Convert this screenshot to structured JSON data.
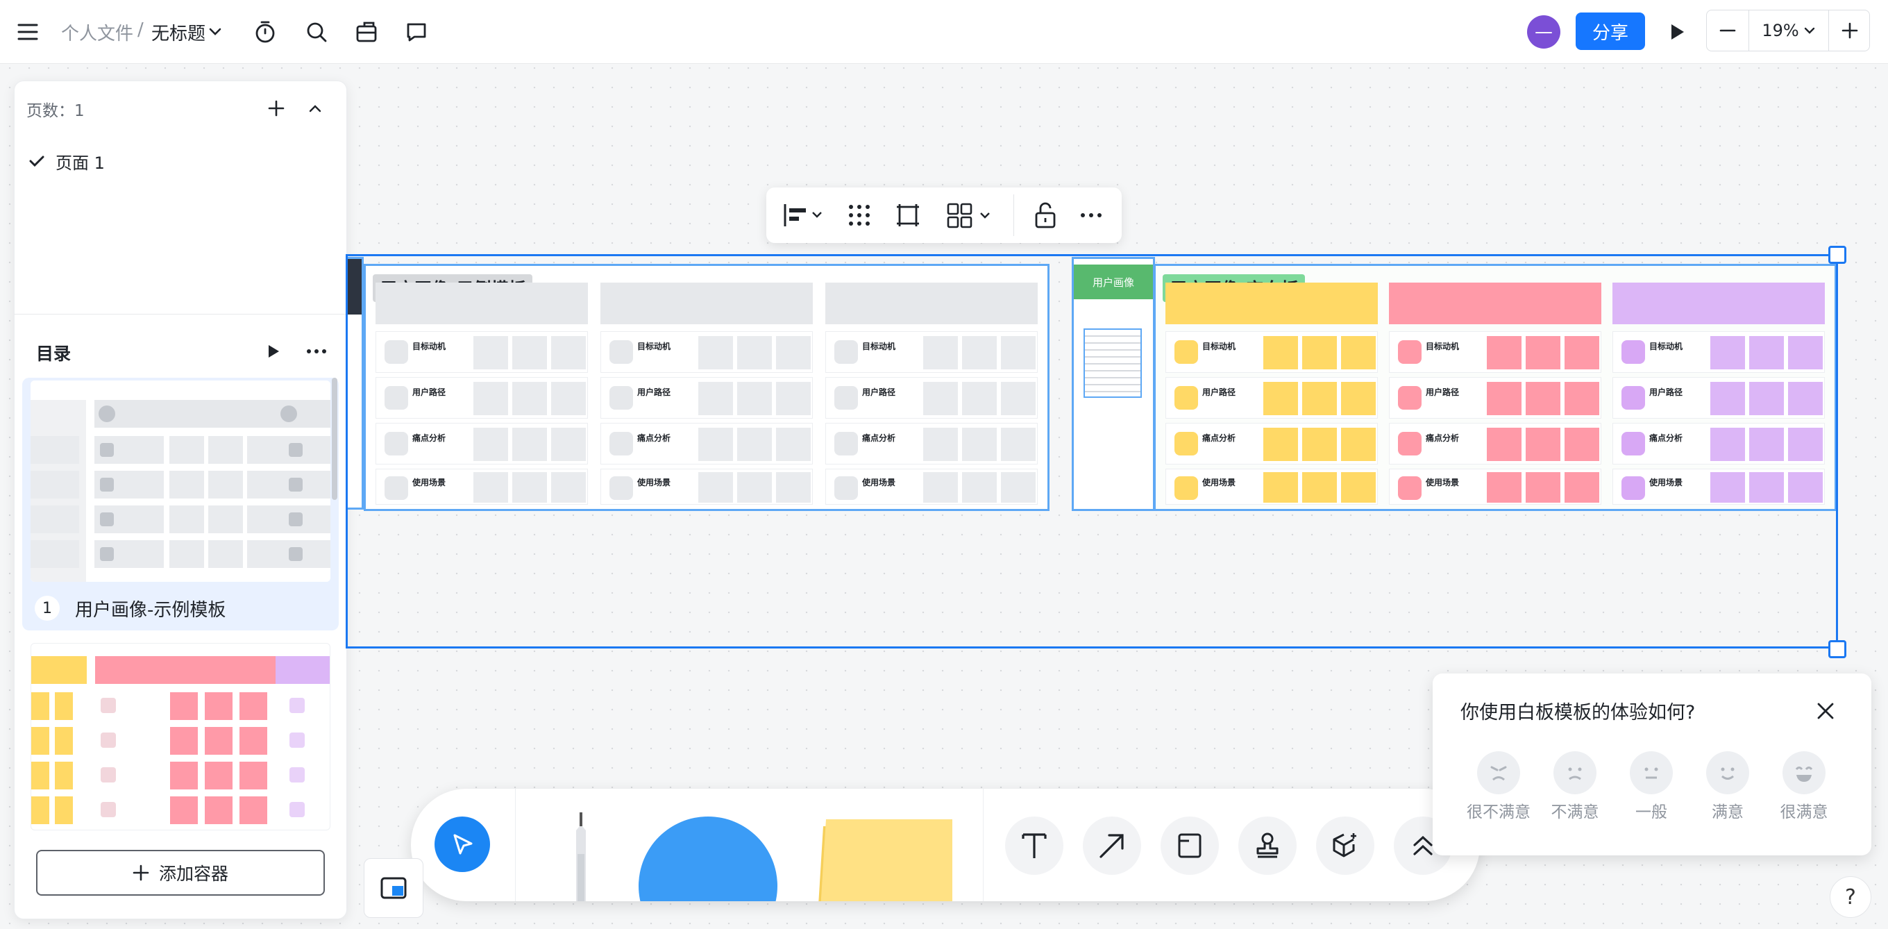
{
  "header": {
    "breadcrumb_parent": "个人文件",
    "breadcrumb_sep": "/",
    "doc_title": "无标题",
    "avatar_text": "—",
    "share_label": "分享",
    "zoom_value": "19%"
  },
  "sidebar": {
    "page_count_label": "页数：1",
    "pages": [
      {
        "label": "页面 1"
      }
    ],
    "toc_title": "目录",
    "toc_items": [
      {
        "index": "1",
        "label": "用户画像-示例模板"
      }
    ],
    "add_container_label": "添加容器"
  },
  "canvas": {
    "board_example_label": "用户画像-示例模板",
    "board_blank_label": "用户画像-空白板",
    "side_card_label": "用户画像",
    "row_titles": [
      "目标动机",
      "用户路径",
      "痛点分析",
      "使用场景"
    ],
    "colors": {
      "selection": "#1b78f2",
      "example_header": "#e6e8eb",
      "blank_yellow": "#ffd966",
      "blank_red": "#ff9aa8",
      "blank_purple": "#dcb6f7",
      "side_green": "#58b96e"
    }
  },
  "survey": {
    "question": "你使用白板模板的体验如何?",
    "options": [
      "很不满意",
      "不满意",
      "一般",
      "满意",
      "很满意"
    ]
  },
  "help_label": "?"
}
